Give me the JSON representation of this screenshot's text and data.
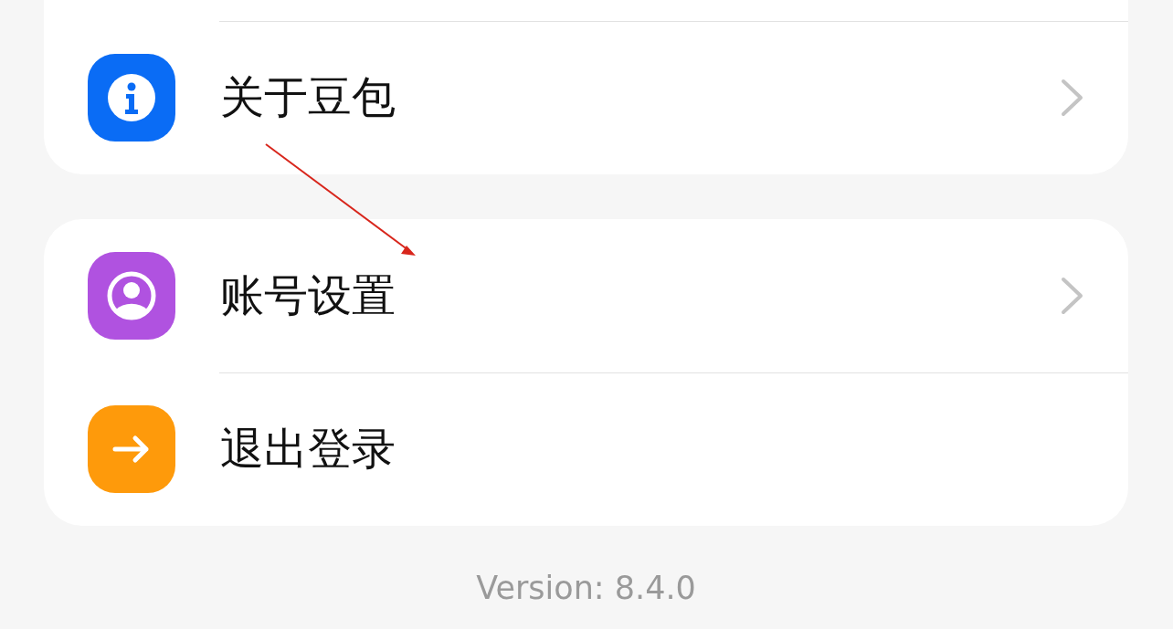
{
  "groups": [
    {
      "items": [
        {
          "label": "关于豆包",
          "kind": "info",
          "color": "#0a6cf5",
          "chevron": true
        }
      ]
    },
    {
      "items": [
        {
          "label": "账号设置",
          "kind": "user",
          "color": "#b052e0",
          "chevron": true
        },
        {
          "label": "退出登录",
          "kind": "logout",
          "color": "#fe9a0b",
          "chevron": false
        }
      ]
    }
  ],
  "version": "Version: 8.4.0"
}
